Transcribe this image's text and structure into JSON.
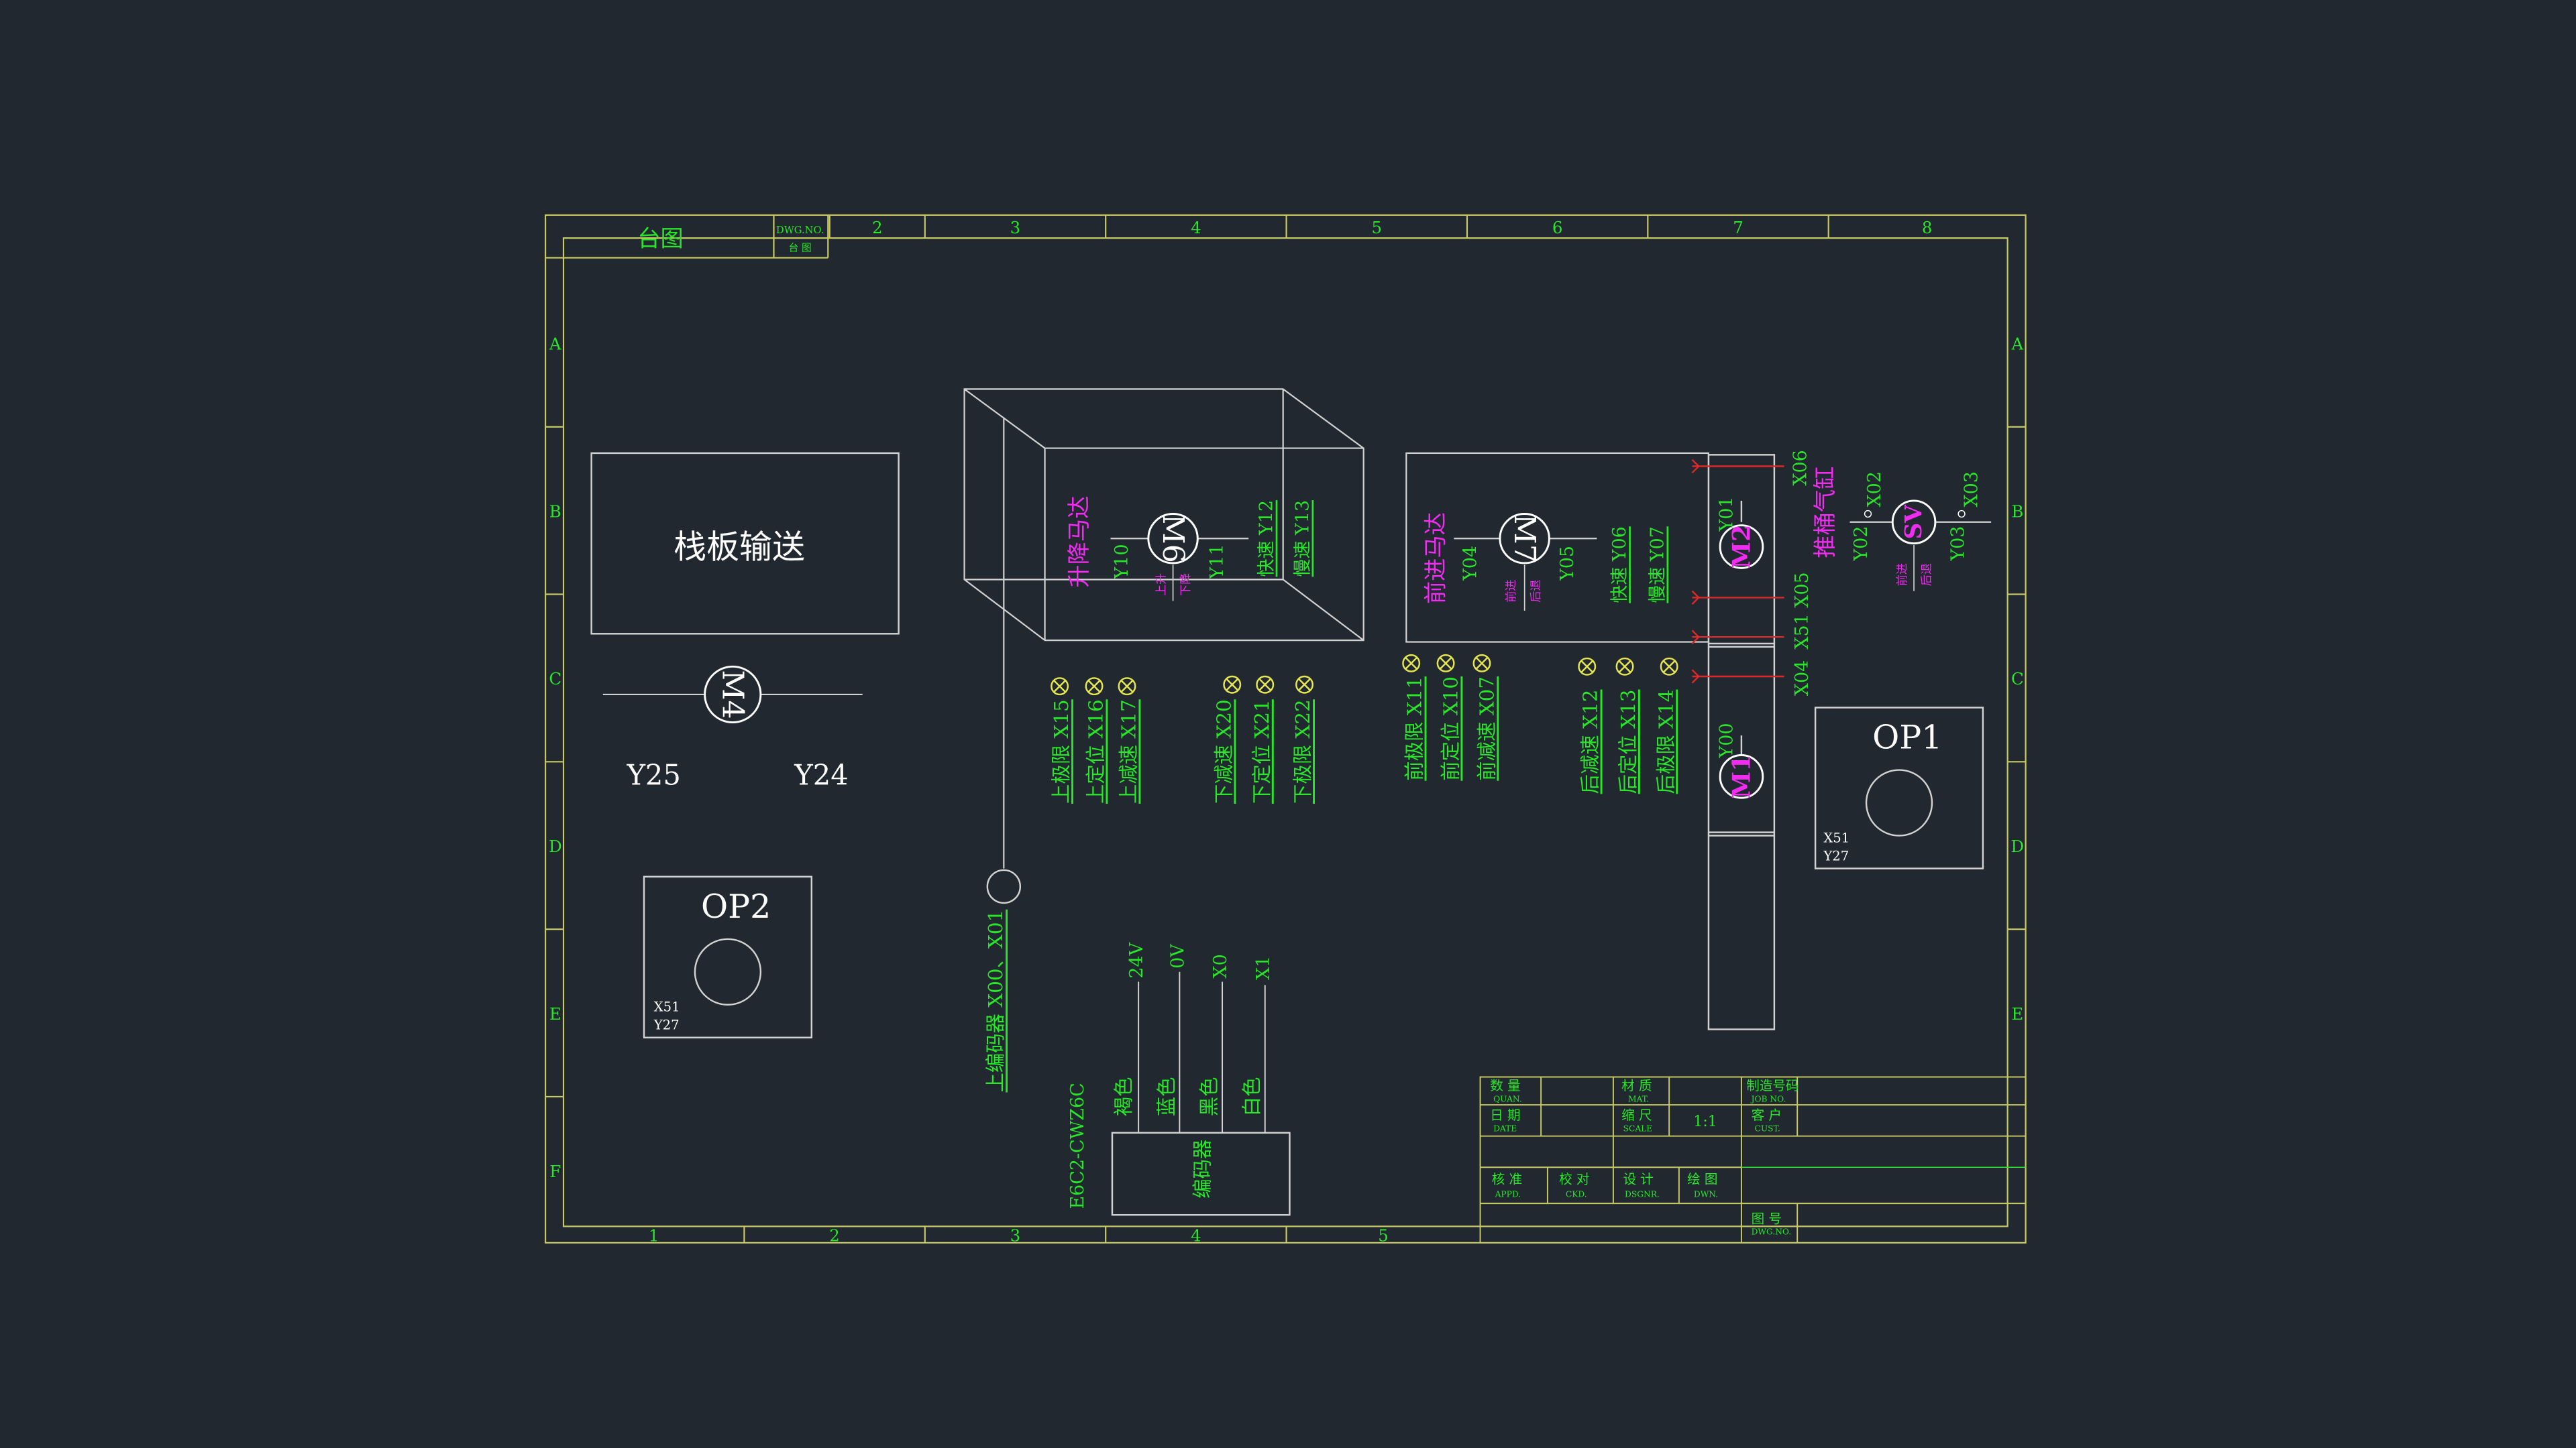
{
  "colors": {
    "background": "#212830",
    "frame": "#c8c864",
    "green": "#28e628",
    "magenta": "#f02cf0",
    "white": "#ffffff",
    "gray": "#d2d2d2",
    "lamp": "#e6e650",
    "red": "#dc2828"
  },
  "frame": {
    "title_tag": "台图",
    "small_tag_top": "DWG.NO.",
    "small_tag_bottom": "台 图",
    "cols_top": [
      "2",
      "3",
      "4",
      "5",
      "6",
      "7",
      "8"
    ],
    "cols_bottom": [
      "1",
      "2",
      "3",
      "4",
      "5"
    ],
    "rows": [
      "A",
      "B",
      "C",
      "D",
      "E",
      "F"
    ]
  },
  "pallet": {
    "box_label": "栈板输送",
    "motor": "M4",
    "left_signal": "Y25",
    "right_signal": "Y24"
  },
  "op2": {
    "title": "OP2",
    "line1": "X51",
    "line2": "Y27"
  },
  "op1": {
    "title": "OP1",
    "line1": "X51",
    "line2": "Y27"
  },
  "lift": {
    "name": "升降马达",
    "motor": "M6",
    "y_left": "Y10",
    "y_right": "Y11",
    "up_label": "上升",
    "down_label": "下降",
    "fast": "快速 Y12",
    "slow": "慢速 Y13"
  },
  "forward": {
    "name": "前进马达",
    "motor": "M7",
    "y_left": "Y04",
    "y_right": "Y05",
    "dir_top": "前进",
    "dir_bottom": "后退",
    "fast": "快速 Y06",
    "slow": "慢速 Y07"
  },
  "lift_sensors": [
    "上极限 X15",
    "上定位 X16",
    "上减速 X17",
    "下减速 X20",
    "下定位 X21",
    "下极限 X22"
  ],
  "fwd_sensors": [
    "前极限 X11",
    "前定位 X10",
    "前减速 X07",
    "后减速 X12",
    "后定位 X13",
    "后极限 X14"
  ],
  "encoder_sensor": "上编码器 X00、X01",
  "encoder": {
    "model": "E6C2-CWZ6C",
    "name": "编码器",
    "pins": [
      "24V",
      "0V",
      "X0",
      "X1"
    ],
    "wires": [
      "褐色",
      "蓝色",
      "黑色",
      "白色"
    ]
  },
  "column": {
    "m2": "M2",
    "m1": "M1",
    "y01": "Y01",
    "y00": "Y00",
    "x06": "X06",
    "x51x05": "X51 X05",
    "x04": "X04"
  },
  "cylinder": {
    "name": "推桶气缸",
    "valve": "SV",
    "x02": "X02",
    "x03": "X03",
    "y02": "Y02",
    "y03": "Y03",
    "dir_top": "前进",
    "dir_bottom": "后退"
  },
  "title_block": {
    "quan_cn": "数 量",
    "quan_en": "QUAN.",
    "mat_cn": "材 质",
    "mat_en": "MAT.",
    "job_cn": "制造号码",
    "job_en": "JOB NO.",
    "date_cn": "日 期",
    "date_en": "DATE",
    "scale_cn": "缩 尺",
    "scale_en": "SCALE",
    "scale_val": "1:1",
    "cust_cn": "客 户",
    "cust_en": "CUST.",
    "appd_cn": "核 准",
    "appd_en": "APPD.",
    "ckd_cn": "校 对",
    "ckd_en": "CKD.",
    "dsgn_cn": "设 计",
    "dsgn_en": "DSGNR.",
    "dwn_cn": "绘 图",
    "dwn_en": "DWN.",
    "dwg_cn": "图 号",
    "dwg_en": "DWG.NO."
  }
}
